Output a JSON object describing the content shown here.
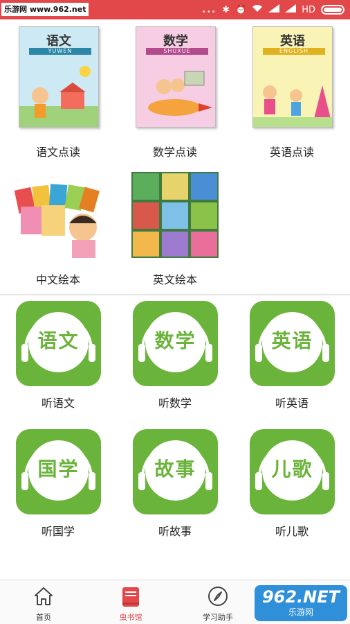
{
  "status_bar": {
    "watermark": "乐游网 www.962.net",
    "dots": "...",
    "network": "HD"
  },
  "books": [
    {
      "label": "语文点读",
      "cover_title": "语文",
      "cover_subtitle": "YUWEN",
      "cover_color": "#2b86a8",
      "cover_bg": "#cde9f3"
    },
    {
      "label": "数学点读",
      "cover_title": "数学",
      "cover_subtitle": "SHUXUE",
      "cover_color": "#b24a8c",
      "cover_bg": "#f6cde3"
    },
    {
      "label": "英语点读",
      "cover_title": "英语",
      "cover_subtitle": "ENGLISH",
      "cover_color": "#e0b21f",
      "cover_bg": "#faf3b6"
    },
    {
      "label": "中文绘本"
    },
    {
      "label": "英文绘本"
    }
  ],
  "audio": [
    {
      "label": "听语文",
      "chars": "语文"
    },
    {
      "label": "听数学",
      "chars": "数学"
    },
    {
      "label": "听英语",
      "chars": "英语"
    },
    {
      "label": "听国学",
      "chars": "国学"
    },
    {
      "label": "听故事",
      "chars": "故事"
    },
    {
      "label": "听儿歌",
      "chars": "儿歌"
    }
  ],
  "nav": {
    "items": [
      {
        "label": "首页",
        "icon": "home-icon"
      },
      {
        "label": "虫书馆",
        "icon": "book-icon"
      },
      {
        "label": "学习助手",
        "icon": "compass-icon"
      }
    ],
    "active_color": "#e2474a"
  },
  "watermark_bottom": {
    "num": "962.NET",
    "text": "乐游网"
  },
  "colors": {
    "status_bar": "#e2474a",
    "audio_green": "#6ab43b"
  }
}
